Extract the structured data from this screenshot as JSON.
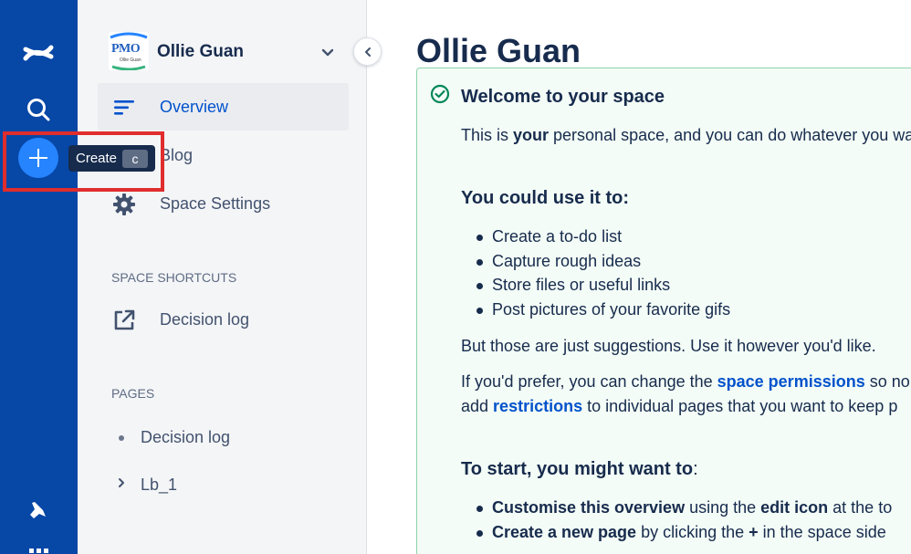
{
  "global_nav": {
    "logo_icon": "confluence-logo-icon",
    "search_icon": "search-icon",
    "create_icon": "plus-icon",
    "notifications_icon": "bell-icon",
    "apps_icon": "apps-grid-icon",
    "brand_color": "#0747a6",
    "create_color": "#2684ff"
  },
  "tooltip": {
    "label": "Create",
    "shortcut": "c"
  },
  "sidebar": {
    "space_logo_text": "PMO",
    "space_logo_subtext": "Ollie Guan",
    "space_name": "Ollie Guan",
    "nav_items": [
      {
        "label": "Overview",
        "icon": "overview-lines-icon",
        "active": true
      },
      {
        "label": "Blog",
        "icon": "quote-icon",
        "active": false
      },
      {
        "label": "Space Settings",
        "icon": "gear-icon",
        "active": false
      }
    ],
    "shortcuts_heading": "SPACE SHORTCUTS",
    "shortcuts": [
      {
        "label": "Decision log",
        "icon": "external-link-icon"
      }
    ],
    "pages_heading": "PAGES",
    "pages": [
      {
        "label": "Decision log",
        "marker": "bullet"
      },
      {
        "label": "Lb_1",
        "marker": "chevron-right"
      }
    ]
  },
  "main": {
    "title": "Ollie Guan",
    "panel": {
      "icon": "check-circle-icon",
      "heading": "Welcome to your space",
      "intro_prefix": "This is ",
      "intro_bold": "your",
      "intro_suffix": " personal space, and you can do whatever you wa",
      "use_heading": "You could use it to:",
      "uses": [
        "Create a to-do list",
        "Capture rough ideas",
        "Store files or useful links",
        "Post pictures of your favorite gifs"
      ],
      "suggestions": "But those are just suggestions. Use it however you'd like.",
      "perm_prefix": "If you'd prefer, you can change the ",
      "perm_link": "space permissions",
      "perm_suffix": " so no",
      "restrict_prefix": "add ",
      "restrict_link": "restrictions",
      "restrict_suffix": " to individual pages that you want to keep p",
      "start_heading": "To start, you might want to",
      "start_colon": ":",
      "tips": [
        {
          "bold": "Customise this overview",
          "mid": " using the ",
          "bold2": "edit icon",
          "rest": " at the to"
        },
        {
          "bold": "Create a new page",
          "mid": " by clicking the ",
          "bold2": "+",
          "rest": " in the space side"
        }
      ]
    },
    "panel_bg": "#f3fcf6",
    "panel_border": "#8fd3aa",
    "link_color": "#0052cc"
  }
}
